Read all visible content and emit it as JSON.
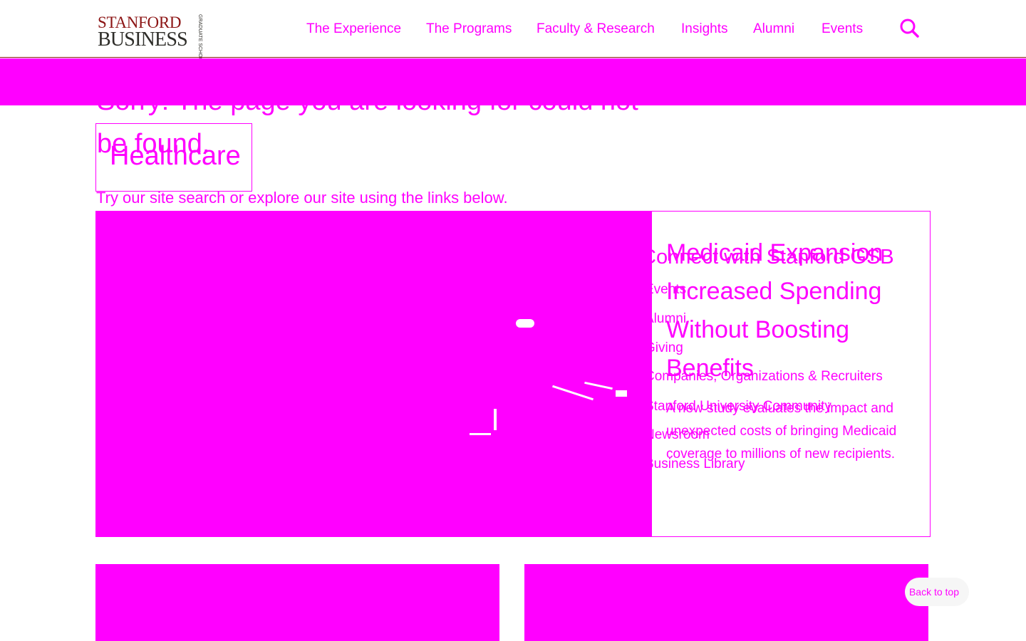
{
  "logo": {
    "line1": "STANFORD",
    "line2": "BUSINESS",
    "side": "GRADUATE SCHOOL OF"
  },
  "nav": {
    "items": [
      {
        "label": "The Experience"
      },
      {
        "label": "The Programs"
      },
      {
        "label": "Faculty & Research"
      },
      {
        "label": "Insights"
      },
      {
        "label": "Alumni"
      },
      {
        "label": "Events"
      }
    ],
    "search_icon": "search-icon"
  },
  "page": {
    "headline": "Sorry! The page you are looking for could not be found.",
    "tag": "Healthcare",
    "subline": "Try our site search or explore our site using the links below."
  },
  "connect": {
    "title": "Connect with Stanford GSB",
    "links": [
      {
        "label": "Events"
      },
      {
        "label": "Alumni"
      },
      {
        "label": "Giving"
      },
      {
        "label": "Companies, Organizations & Recruiters"
      },
      {
        "label": "Stanford University Community"
      },
      {
        "label": "Newsroom"
      },
      {
        "label": "Business Library"
      }
    ]
  },
  "card": {
    "title": "Medicaid Expansion Increased Spending Without Boosting Benefits",
    "description": "A new study evaluates the impact and unexpected costs of bringing Medicaid coverage to millions of new recipients."
  },
  "back_to_top": "Back to top",
  "colors": {
    "accent": "#ff00ff",
    "brand_red": "#8c1515",
    "logo_dark": "#2e2d29"
  }
}
